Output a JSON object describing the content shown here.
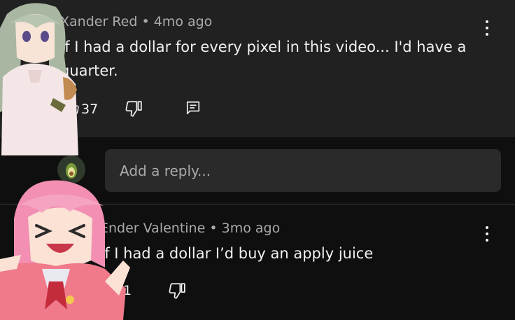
{
  "comments": [
    {
      "author": "Xander Red",
      "time": "4mo ago",
      "text_line1": "If I had a dollar for every pixel in this video... I'd have a",
      "text_line2": "quarter.",
      "likes": "37"
    },
    {
      "author": "Ender Valentine",
      "time": "3mo ago",
      "text": "If I had a dollar I’d buy an apply juice",
      "likes": "1"
    }
  ],
  "reply": {
    "placeholder": "Add a reply..."
  },
  "separator": "•",
  "colors": {
    "comment_bg": "#212121",
    "page_bg": "#0f0f0f",
    "reply_box_bg": "#2a2a2a",
    "meta_text": "#aaaaaa",
    "primary_text": "#f1f1f1"
  },
  "icons": [
    "thumb-up-icon",
    "thumb-down-icon",
    "reply-icon",
    "more-vert-icon"
  ]
}
